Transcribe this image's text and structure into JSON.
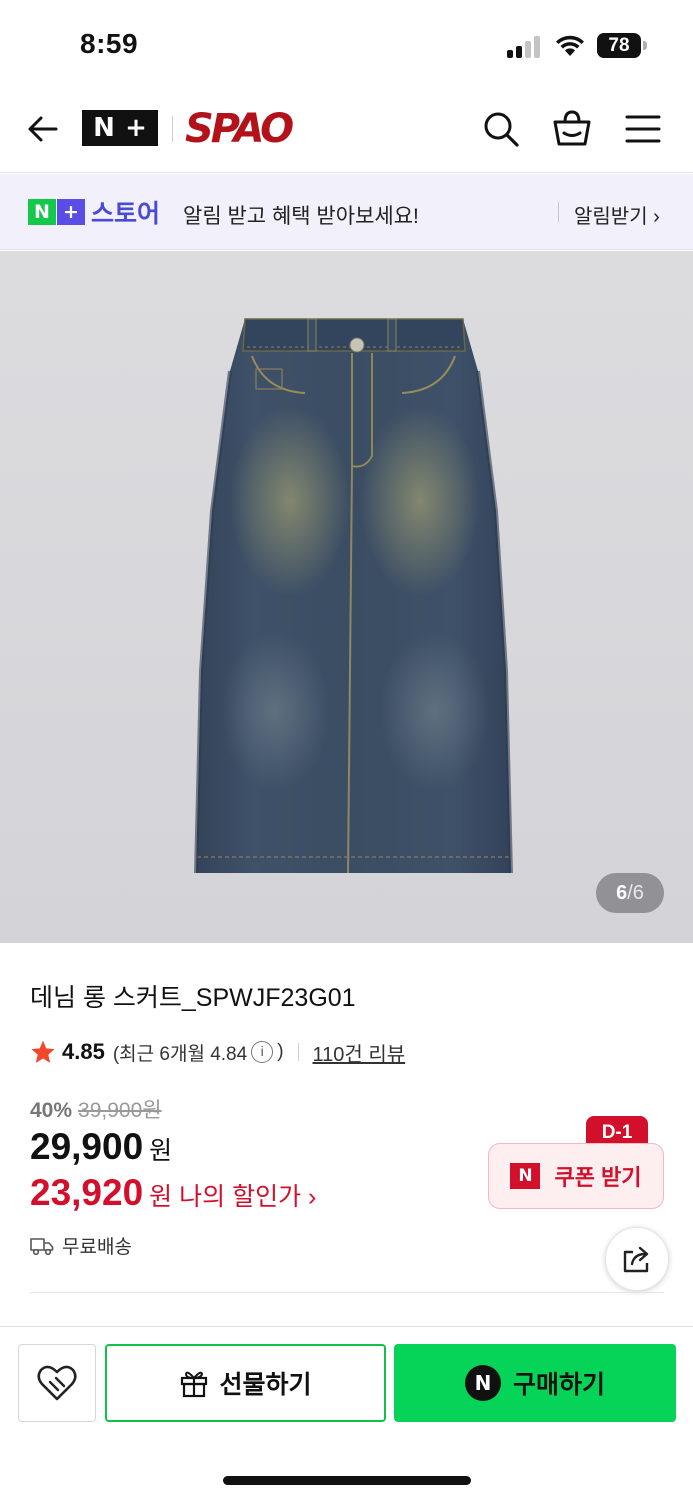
{
  "status": {
    "time": "8:59",
    "battery": "78"
  },
  "header": {
    "brand_badge": [
      "N",
      "+"
    ],
    "brand_name": "SPAO"
  },
  "banner": {
    "badge": [
      "N",
      "+"
    ],
    "store": "스토어",
    "message": "알림 받고 혜택 받아보세요!",
    "link": "알림받기 ›",
    "colors": {
      "n_box": "#14c94a",
      "plus_box": "#5b4ee6"
    }
  },
  "gallery": {
    "current": "6",
    "separator": "/",
    "total": "6"
  },
  "product": {
    "title": "데님 롱 스커트_SPWJF23G01",
    "rating": "4.85",
    "recent_prefix": "(최근 6개월 4.84",
    "recent_suffix": ")",
    "reviews": "110건 리뷰",
    "discount_rate": "40%",
    "original_price": "39,900원",
    "price": "29,900",
    "currency": "원",
    "my_price": "23,920",
    "my_price_label": "원 나의 할인가 ›",
    "shipping": "무료배송"
  },
  "coupon": {
    "dday": "D-1",
    "badge": "N",
    "label": "쿠폰 받기"
  },
  "bottom_bar": {
    "gift_label": "선물하기",
    "buy_badge": "N",
    "buy_label": "구매하기"
  },
  "colors": {
    "accent_red": "#d3102c",
    "naver_green": "#05d458",
    "brand_red": "#b4121b"
  }
}
